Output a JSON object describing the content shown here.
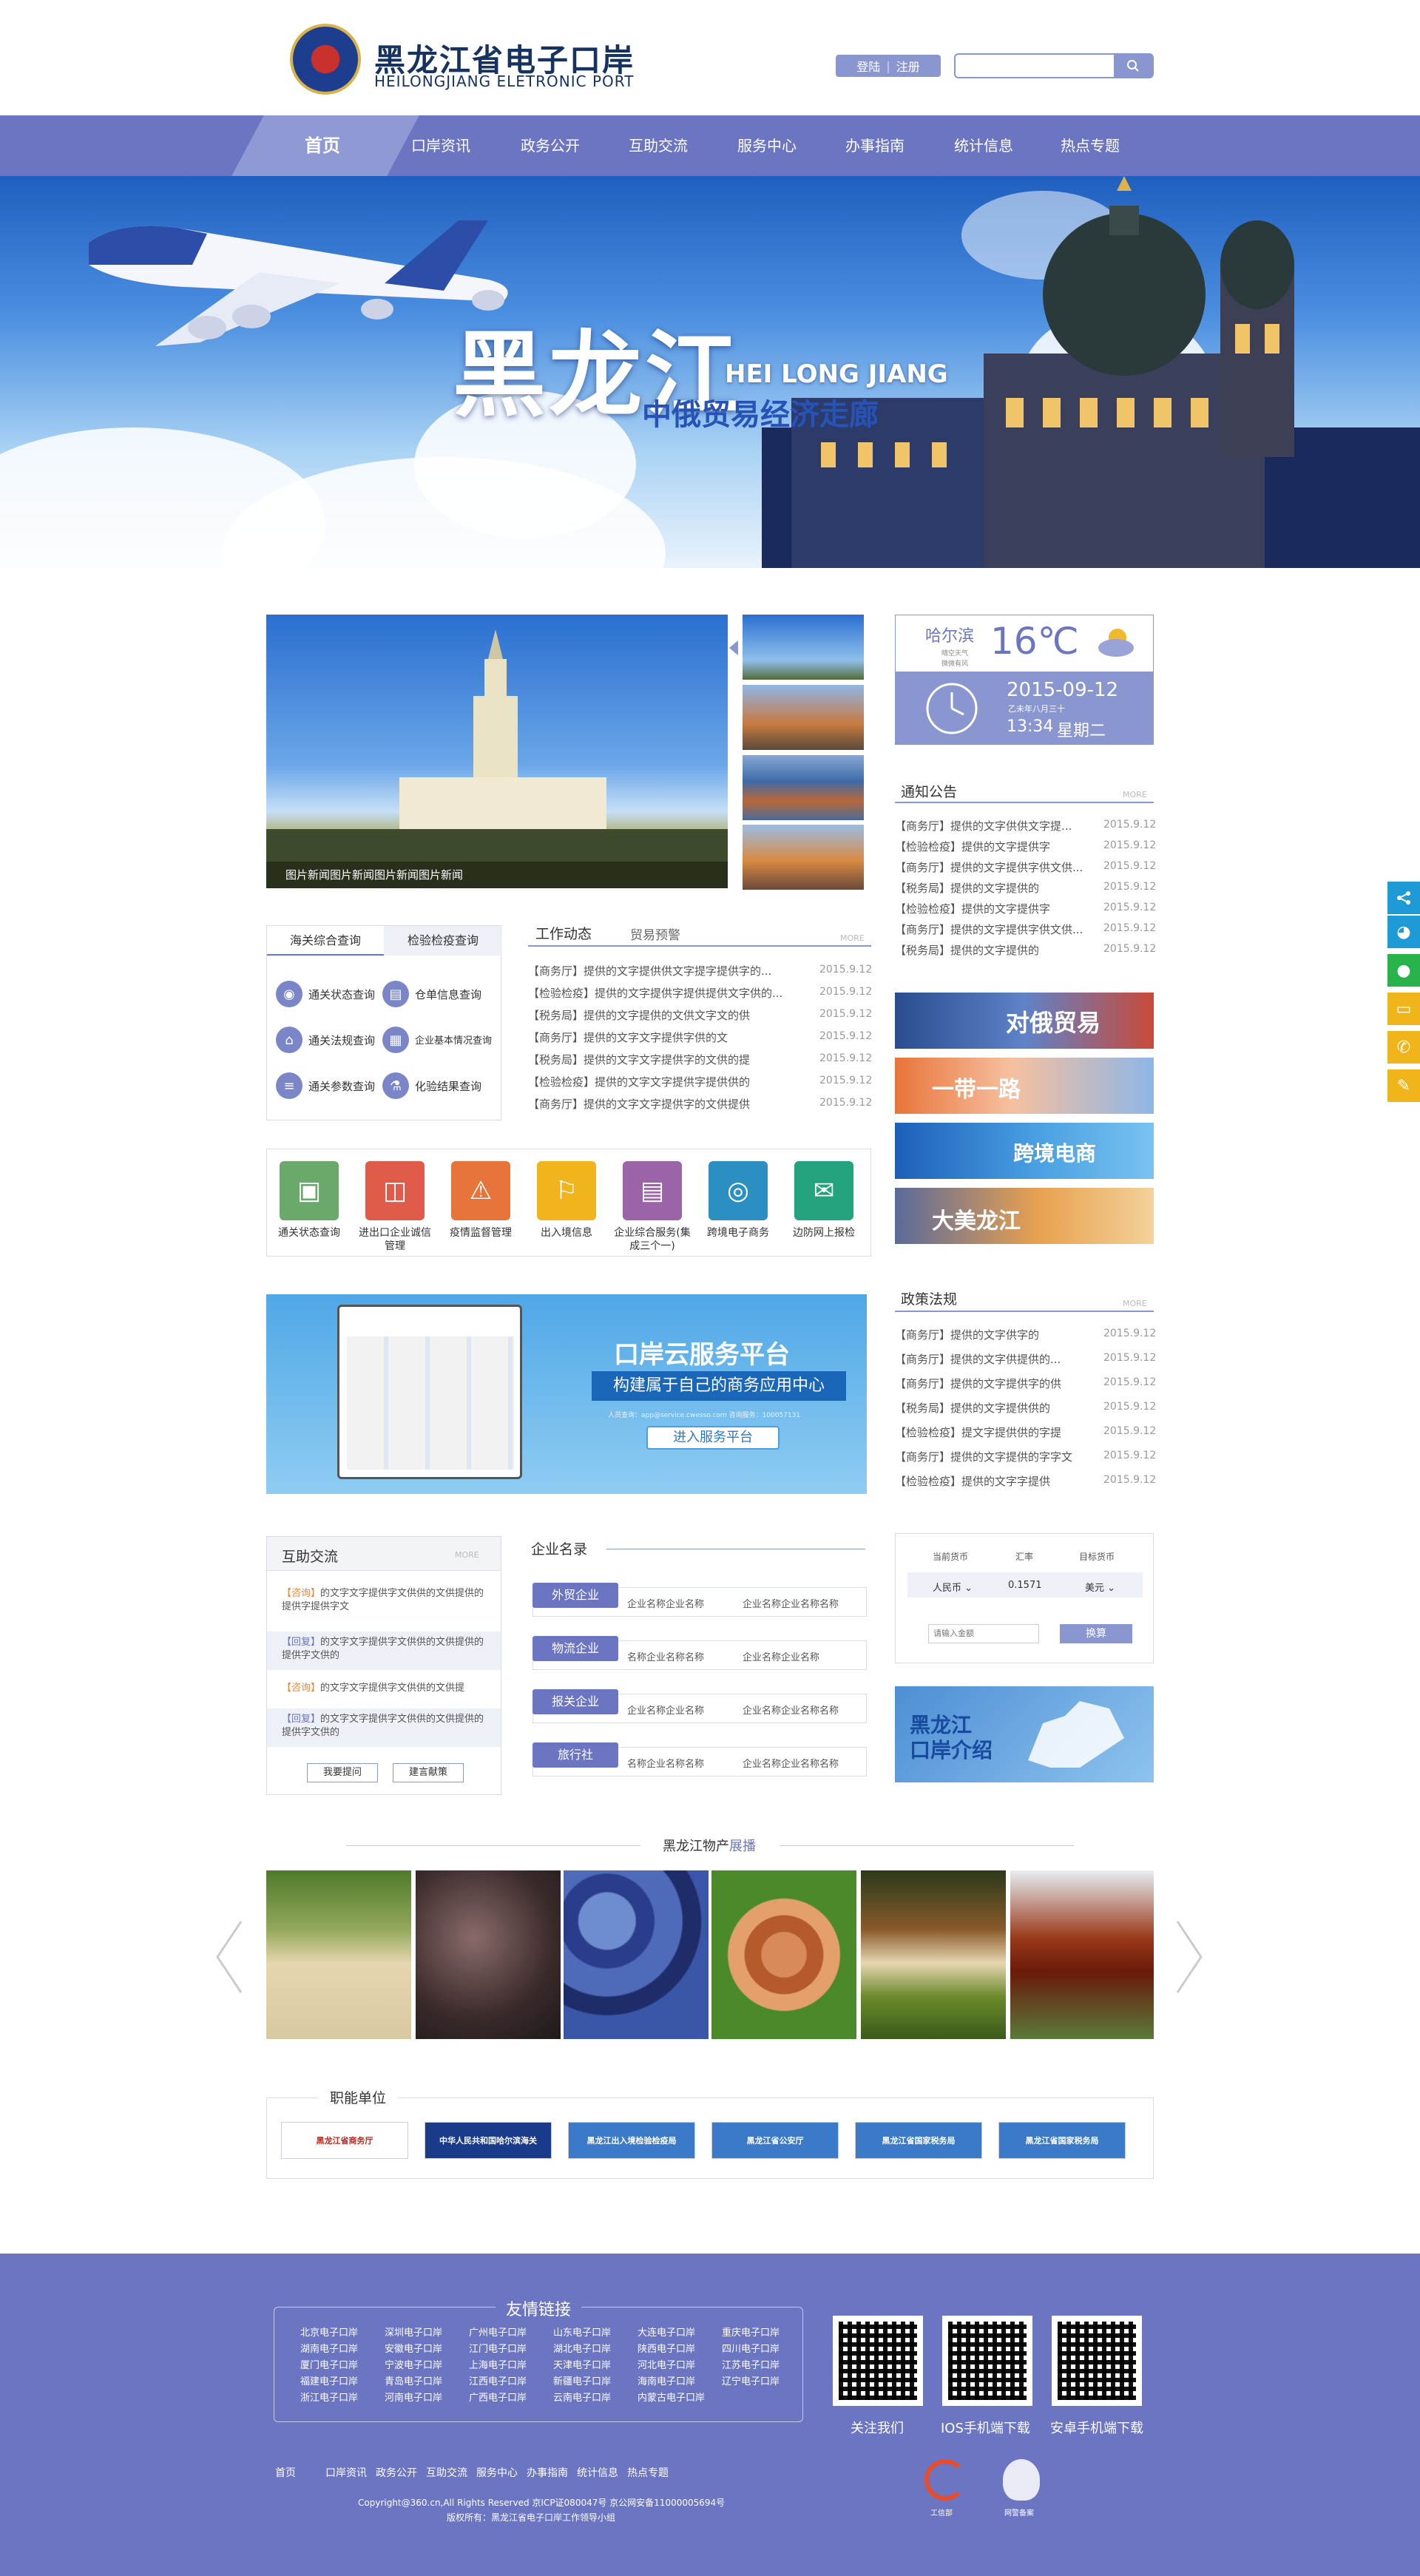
{
  "header": {
    "logo_cn": "黑龙江省电子口岸",
    "logo_en": "HEILONGJIANG ELETRONIC PORT",
    "login": "登陆",
    "register": "注册",
    "search_placeholder": ""
  },
  "nav": {
    "items": [
      "首页",
      "口岸资讯",
      "政务公开",
      "互助交流",
      "服务中心",
      "办事指南",
      "统计信息",
      "热点专题"
    ]
  },
  "banner": {
    "title": "黑龙江",
    "title_en": "HEI LONG JIANG",
    "subtitle": "中俄贸易经济走廊"
  },
  "slider": {
    "caption": "图片新闻图片新闻图片新闻图片新闻"
  },
  "weather": {
    "city": "哈尔滨",
    "temp": "16℃",
    "note1": "晴空天气",
    "note2": "微微有风",
    "date": "2015-09-12",
    "lunar": "乙未年八月三十",
    "time": "13:34",
    "weekday": "星期二"
  },
  "notices": {
    "title": "通知公告",
    "more": "MORE",
    "items": [
      {
        "text": "【商务厅】提供的文字供供文字提...",
        "date": "2015.9.12"
      },
      {
        "text": "【检验检疫】提供的文字提供字",
        "date": "2015.9.12"
      },
      {
        "text": "【商务厅】提供的文字提供字供文供...",
        "date": "2015.9.12"
      },
      {
        "text": "【税务局】提供的文字提供的",
        "date": "2015.9.12"
      },
      {
        "text": "【检验检疫】提供的文字提供字",
        "date": "2015.9.12"
      },
      {
        "text": "【商务厅】提供的文字提供字供文供...",
        "date": "2015.9.12"
      },
      {
        "text": "【税务局】提供的文字提供的",
        "date": "2015.9.12"
      }
    ]
  },
  "query": {
    "tab1": "海关综合查询",
    "tab2": "检验检疫查询",
    "items": [
      "通关状态查询",
      "仓单信息查询",
      "通关法规查询",
      "企业基本情况查询",
      "通关参数查询",
      "化验结果查询"
    ]
  },
  "work": {
    "tab1": "工作动态",
    "tab2": "贸易预警",
    "more": "MORE",
    "items": [
      {
        "text": "【商务厅】提供的文字提供供文字提字提供字的...",
        "date": "2015.9.12"
      },
      {
        "text": "【检验检疫】提供的文字提供字提供提供文字供的...",
        "date": "2015.9.12"
      },
      {
        "text": "【税务局】提供的文字提供的文供文字文的供",
        "date": "2015.9.12"
      },
      {
        "text": "【商务厅】提供的文字文字提供字供的文",
        "date": "2015.9.12"
      },
      {
        "text": "【税务局】提供的文字文字提供字的文供的提",
        "date": "2015.9.12"
      },
      {
        "text": "【检验检疫】提供的文字文字提供字提供供的",
        "date": "2015.9.12"
      },
      {
        "text": "【商务厅】提供的文字文字提供字的文供提供",
        "date": "2015.9.12"
      }
    ]
  },
  "services": [
    {
      "label": "通关状态查询",
      "color": "#6aa96b"
    },
    {
      "label": "进出口企业诚信管理",
      "color": "#e05b4a"
    },
    {
      "label": "疫情监督管理",
      "color": "#e7743a"
    },
    {
      "label": "出入境信息",
      "color": "#f0b41d"
    },
    {
      "label": "企业综合服务(集成三个一)",
      "color": "#9b64a8"
    },
    {
      "label": "跨境电子商务",
      "color": "#2b8fc2"
    },
    {
      "label": "边防网上报检",
      "color": "#23a37e"
    }
  ],
  "promos": [
    "对俄贸易",
    "一带一路",
    "跨境电商",
    "大美龙江"
  ],
  "cloud": {
    "title": "口岸云服务平台",
    "subtitle": "构建属于自己的商务应用中心",
    "contact": "人员查询：app@service.cwesso.com  咨询服务：100057131",
    "button": "进入服务平台"
  },
  "policy": {
    "title": "政策法规",
    "more": "MORE",
    "items": [
      {
        "text": "【商务厅】提供的文字供字的",
        "date": "2015.9.12"
      },
      {
        "text": "【商务厅】提供的文字供提供的...",
        "date": "2015.9.12"
      },
      {
        "text": "【商务厅】提供的文字提供字的供",
        "date": "2015.9.12"
      },
      {
        "text": "【税务局】提供的文字提供供的",
        "date": "2015.9.12"
      },
      {
        "text": "【检验检疫】提文字提供供的字提",
        "date": "2015.9.12"
      },
      {
        "text": "【商务厅】提供的文字提供的字字文",
        "date": "2015.9.12"
      },
      {
        "text": "【检验检疫】提供的文字字提供",
        "date": "2015.9.12"
      }
    ]
  },
  "mutual": {
    "title": "互助交流",
    "more": "MORE",
    "items": [
      {
        "tag": "【咨询】",
        "text": "的文字文字提供字文供供的文供提供的提供字提供字文"
      },
      {
        "tag": "【回复】",
        "text": "的文字文字提供字文供供的文供提供的提供字文供的"
      },
      {
        "tag": "【咨询】",
        "text": "的文字文字提供字文供供的文供提"
      },
      {
        "tag": "【回复】",
        "text": "的文字文字提供字文供供的文供提供的提供字文供的"
      }
    ],
    "btn_ask": "我要提问",
    "btn_suggest": "建言献策"
  },
  "directory": {
    "title": "企业名录",
    "rows": [
      {
        "tag": "外贸企业",
        "items": [
          "企业名称企业名称",
          "企业名称企业名称名称"
        ]
      },
      {
        "tag": "物流企业",
        "items": [
          "名称企业名称名称",
          "企业名称企业名称"
        ]
      },
      {
        "tag": "报关企业",
        "items": [
          "企业名称企业名称",
          "企业名称企业名称名称"
        ]
      },
      {
        "tag": "旅行社",
        "items": [
          "名称企业名称名称",
          "企业名称企业名称名称"
        ]
      }
    ]
  },
  "exchange": {
    "h1": "当前货币",
    "h2": "汇率",
    "h3": "目标货币",
    "from": "人民币",
    "rate": "0.1571",
    "to": "美元",
    "placeholder": "请输入金额",
    "button": "换算"
  },
  "port_intro": "黑龙江\n口岸介绍",
  "products": {
    "title": "黑龙江物产",
    "title_accent": "展播"
  },
  "units": {
    "title": "职能单位",
    "logos": [
      "黑龙江省商务厅",
      "中华人民共和国哈尔滨海关",
      "黑龙江出入境检验检疫局",
      "黑龙江省公安厅",
      "黑龙江省国家税务局",
      "黑龙江省国家税务局"
    ]
  },
  "footer": {
    "links_title": "友情链接",
    "friend_links": [
      [
        "北京电子口岸",
        "深圳电子口岸",
        "广州电子口岸",
        "山东电子口岸",
        "大连电子口岸",
        "重庆电子口岸"
      ],
      [
        "湖南电子口岸",
        "安徽电子口岸",
        "江门电子口岸",
        "湖北电子口岸",
        "陕西电子口岸",
        "四川电子口岸"
      ],
      [
        "厦门电子口岸",
        "宁波电子口岸",
        "上海电子口岸",
        "天津电子口岸",
        "河北电子口岸",
        "江苏电子口岸"
      ],
      [
        "福建电子口岸",
        "青岛电子口岸",
        "江西电子口岸",
        "新疆电子口岸",
        "海南电子口岸",
        "辽宁电子口岸"
      ],
      [
        "浙江电子口岸",
        "河南电子口岸",
        "广西电子口岸",
        "云南电子口岸",
        "内蒙古电子口岸",
        ""
      ]
    ],
    "qr": [
      "关注我们",
      "IOS手机端下载",
      "安卓手机端下载"
    ],
    "nav": [
      "首页",
      "口岸资讯",
      "政务公开",
      "互助交流",
      "服务中心",
      "办事指南",
      "统计信息",
      "热点专题"
    ],
    "copyright": "Copyright@360.cn,All Rights Reserved 京ICP证080047号  京公网安备11000005694号",
    "owner": "版权所有：黑龙江省电子口岸工作领导小组",
    "badge1": "工信部",
    "badge2": "网警备案"
  }
}
